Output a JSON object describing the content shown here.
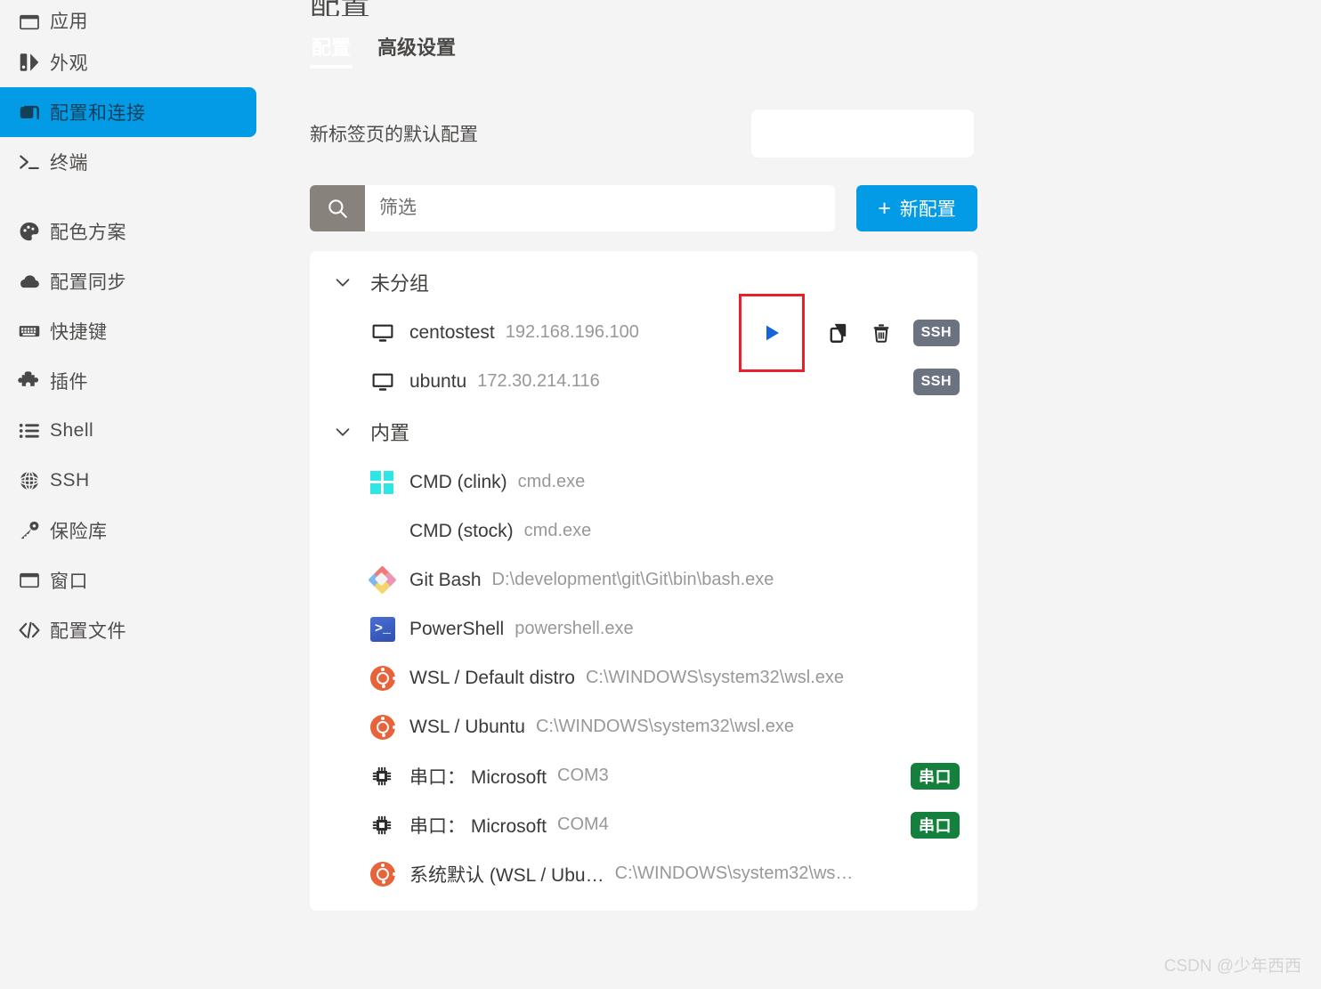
{
  "accent_color": "#039be5",
  "annotation_color": "#e8202a",
  "sidebar": {
    "items": [
      {
        "label": "应用",
        "icon": "window-icon",
        "active": false
      },
      {
        "label": "外观",
        "icon": "contrast-icon",
        "active": false
      },
      {
        "label": "配置和连接",
        "icon": "profiles-icon",
        "active": true
      },
      {
        "label": "终端",
        "icon": "terminal-icon",
        "active": false
      },
      {
        "label": "配色方案",
        "icon": "palette-icon",
        "active": false
      },
      {
        "label": "配置同步",
        "icon": "cloud-icon",
        "active": false
      },
      {
        "label": "快捷键",
        "icon": "keyboard-icon",
        "active": false
      },
      {
        "label": "插件",
        "icon": "puzzle-icon",
        "active": false
      },
      {
        "label": "Shell",
        "icon": "list-icon",
        "active": false
      },
      {
        "label": "SSH",
        "icon": "globe-icon",
        "active": false
      },
      {
        "label": "保险库",
        "icon": "key-icon",
        "active": false
      },
      {
        "label": "窗口",
        "icon": "window-icon",
        "active": false
      },
      {
        "label": "配置文件",
        "icon": "code-icon",
        "active": false
      }
    ]
  },
  "main": {
    "page_title": "配置",
    "tabs": [
      {
        "label": "配置",
        "active": true
      },
      {
        "label": "高级设置",
        "active": false
      }
    ],
    "default_profile": {
      "label": "新标签页的默认配置",
      "value": "",
      "placeholder": ""
    },
    "filter": {
      "placeholder": "筛选",
      "value": "",
      "icon": "search-icon"
    },
    "new_button": {
      "label": "新配置",
      "plus": "+"
    }
  },
  "groups": [
    {
      "name": "未分组",
      "expanded": true,
      "chevron": "chevron-down-icon",
      "rows": [
        {
          "icon": "monitor-icon",
          "name": "centostest",
          "sub": "192.168.196.100",
          "badge": {
            "text": "SSH",
            "kind": "ssh"
          },
          "actions": [
            {
              "name": "launch-button",
              "icon": "play-icon",
              "annotated": true
            },
            {
              "name": "duplicate-button",
              "icon": "copy-icon",
              "annotated": false
            },
            {
              "name": "delete-button",
              "icon": "trash-icon",
              "annotated": false
            }
          ]
        },
        {
          "icon": "monitor-icon",
          "name": "ubuntu",
          "sub": "172.30.214.116",
          "badge": {
            "text": "SSH",
            "kind": "ssh"
          },
          "actions": []
        }
      ]
    },
    {
      "name": "内置",
      "expanded": true,
      "chevron": "chevron-down-icon",
      "rows": [
        {
          "icon": "windows-icon",
          "name": "CMD (clink)",
          "sub": "cmd.exe",
          "badge": null,
          "actions": []
        },
        {
          "icon": "none",
          "name": "CMD (stock)",
          "sub": "cmd.exe",
          "badge": null,
          "actions": []
        },
        {
          "icon": "git-icon",
          "name": "Git Bash",
          "sub": "D:\\development\\git\\Git\\bin\\bash.exe",
          "badge": null,
          "actions": []
        },
        {
          "icon": "powershell-icon",
          "name": "PowerShell",
          "sub": "powershell.exe",
          "badge": null,
          "actions": []
        },
        {
          "icon": "ubuntu-icon",
          "name": "WSL / Default distro",
          "sub": "C:\\WINDOWS\\system32\\wsl.exe",
          "badge": null,
          "actions": []
        },
        {
          "icon": "ubuntu-icon",
          "name": "WSL / Ubuntu",
          "sub": "C:\\WINDOWS\\system32\\wsl.exe",
          "badge": null,
          "actions": []
        },
        {
          "icon": "chip-icon",
          "name": "串口： Microsoft",
          "sub": "COM3",
          "badge": {
            "text": "串口",
            "kind": "serial"
          },
          "actions": []
        },
        {
          "icon": "chip-icon",
          "name": "串口： Microsoft",
          "sub": "COM4",
          "badge": {
            "text": "串口",
            "kind": "serial"
          },
          "actions": []
        },
        {
          "icon": "ubuntu-icon",
          "name": "系统默认 (WSL / Ubu…",
          "sub": "C:\\WINDOWS\\system32\\ws…",
          "badge": null,
          "actions": []
        }
      ]
    }
  ],
  "watermark": "CSDN @少年西西"
}
